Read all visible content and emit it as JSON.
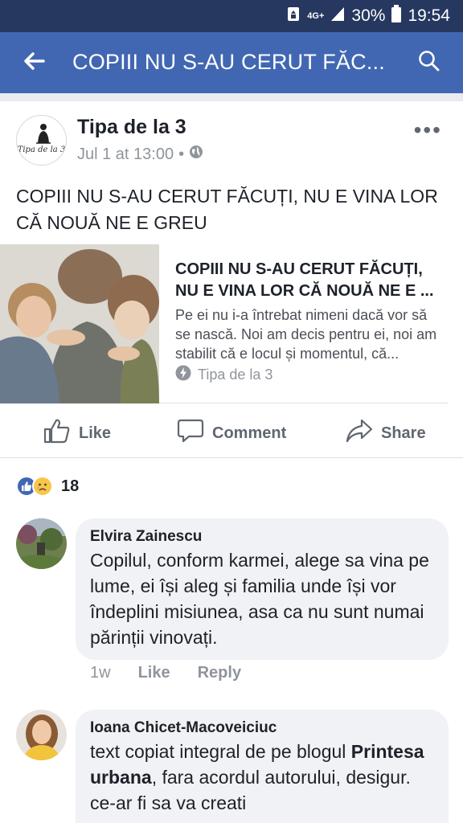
{
  "status_bar": {
    "network": "4G+",
    "battery_percent": "30%",
    "time": "19:54",
    "icons": [
      "recycle-notification-icon",
      "signal-icon",
      "battery-icon"
    ]
  },
  "app_bar": {
    "title": "COPIII NU S-AU CERUT FĂC...",
    "back_icon": "back-arrow-icon",
    "search_icon": "search-icon"
  },
  "post": {
    "author": "Tipa de la 3",
    "avatar_logo_text": "Tipa de la 3",
    "date": "Jul 1 at 13:00",
    "separator": "•",
    "privacy_icon": "globe-icon",
    "more_label": "•••",
    "text": "COPIII NU S-AU CERUT FĂCUȚI, NU E VINA LOR CĂ NOUĂ NE E GREU",
    "link": {
      "title": "COPIII NU S-AU CERUT FĂCUȚI, NU E VINA LOR CĂ NOUĂ NE E ...",
      "description": "Pe ei nu i-a întrebat nimeni dacă vor să se nască. Noi am decis pentru ei, noi am stabilit că e locul și momentul, că...",
      "source": "Tipa de la 3"
    }
  },
  "actions": {
    "like": "Like",
    "comment": "Comment",
    "share": "Share"
  },
  "reactions": {
    "count": "18",
    "types": [
      "like",
      "sad"
    ]
  },
  "comments": [
    {
      "name": "Elvira Zainescu",
      "text": "Copilul, conform karmei, alege sa vina pe lume, ei își aleg și familia unde își vor îndeplini misiunea, asa ca nu sunt numai părinții vinovați.",
      "time": "1w",
      "like": "Like",
      "reply": "Reply"
    },
    {
      "name": "Ioana Chicet-Macoveiciuc",
      "text_before": "text copiat integral de pe blogul ",
      "text_bold": "Printesa urbana",
      "text_after": ", fara acordul autorului, desigur. ce-ar fi sa va creati"
    }
  ],
  "colors": {
    "status_bar": "#26385f",
    "app_bar": "#4267b2",
    "bubble": "#f0f2f5",
    "secondary_text": "#90949c"
  }
}
